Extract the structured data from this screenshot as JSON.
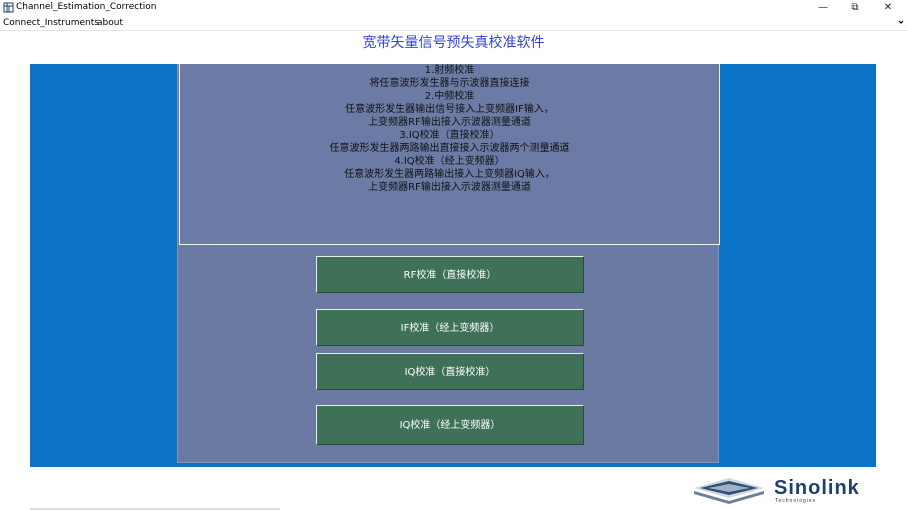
{
  "window": {
    "title": "Channel_Estimation_Correction",
    "minimize_symbol": "—",
    "maximize_symbol": "⧉",
    "close_symbol": "✕"
  },
  "menu": {
    "items": [
      "Connect_Instruments",
      "about"
    ]
  },
  "header": {
    "title": "宽带矢量信号预失真校准软件"
  },
  "instructions": [
    "1.射频校准",
    "将任意波形发生器与示波器直接连接",
    "2.中频校准",
    "任意波形发生器输出信号接入上变频器IF输入，",
    "上变频器RF输出接入示波器测量通道",
    "3.IQ校准（直接校准）",
    "任意波形发生器两路输出直接接入示波器两个测量通道",
    "4.IQ校准（经上变频器）",
    "任意波形发生器两路输出接入上变频器IQ输入，",
    "上变频器RF输出接入示波器测量通道"
  ],
  "buttons": {
    "rf": "RF校准（直接校准）",
    "if": "IF校准（经上变频器）",
    "iq_direct": "IQ校准（直接校准）",
    "iq_upconv": "IQ校准（经上变频器）"
  },
  "logo": {
    "brand": "Sinolink",
    "sub": "Technologies"
  },
  "colors": {
    "accent_blue": "#0a73c5",
    "panel": "#6a7aa3",
    "button": "#3e7158",
    "header_text": "#3543d4"
  }
}
